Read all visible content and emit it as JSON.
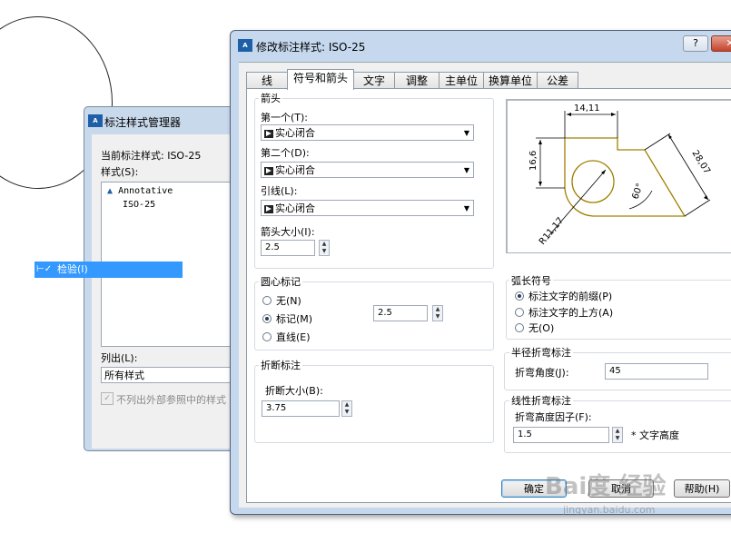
{
  "manager": {
    "title": "标注样式管理器",
    "current_label": "当前标注样式: ISO-25",
    "styles_label": "样式(S):",
    "styles": [
      "Annotative",
      "ISO-25"
    ],
    "list_label": "列出(L):",
    "list_value": "所有样式",
    "checkbox_label": "不列出外部参照中的样式"
  },
  "popup": {
    "label": "检验(I)"
  },
  "dialog": {
    "title": "修改标注样式: ISO-25",
    "help": "?",
    "close": "✕",
    "tabs": [
      "线",
      "符号和箭头",
      "文字",
      "调整",
      "主单位",
      "换算单位",
      "公差"
    ],
    "active_tab": 1,
    "arrows": {
      "title": "箭头",
      "first_label": "第一个(T):",
      "first_value": "实心闭合",
      "second_label": "第二个(D):",
      "second_value": "实心闭合",
      "leader_label": "引线(L):",
      "leader_value": "实心闭合",
      "size_label": "箭头大小(I):",
      "size_value": "2.5"
    },
    "center": {
      "title": "圆心标记",
      "none_label": "无(N)",
      "mark_label": "标记(M)",
      "line_label": "直线(E)",
      "selected": "mark",
      "size_value": "2.5"
    },
    "break": {
      "title": "折断标注",
      "size_label": "折断大小(B):",
      "size_value": "3.75"
    },
    "arc": {
      "title": "弧长符号",
      "prefix_label": "标注文字的前缀(P)",
      "above_label": "标注文字的上方(A)",
      "none_label": "无(O)",
      "selected": "prefix"
    },
    "radius_jog": {
      "title": "半径折弯标注",
      "angle_label": "折弯角度(J):",
      "angle_value": "45"
    },
    "linear_jog": {
      "title": "线性折弯标注",
      "factor_label": "折弯高度因子(F):",
      "factor_value": "1.5",
      "factor_suffix": "* 文字高度"
    },
    "preview": {
      "dim_top": "14,11",
      "dim_left": "16,6",
      "dim_diag": "28,07",
      "dim_angle": "60°",
      "dim_radius": "R11,17"
    },
    "buttons": {
      "ok": "确定",
      "cancel": "取消",
      "help": "帮助(H)"
    }
  },
  "watermark": {
    "main": "Bai度 经验",
    "sub": "jingyan.baidu.com"
  }
}
